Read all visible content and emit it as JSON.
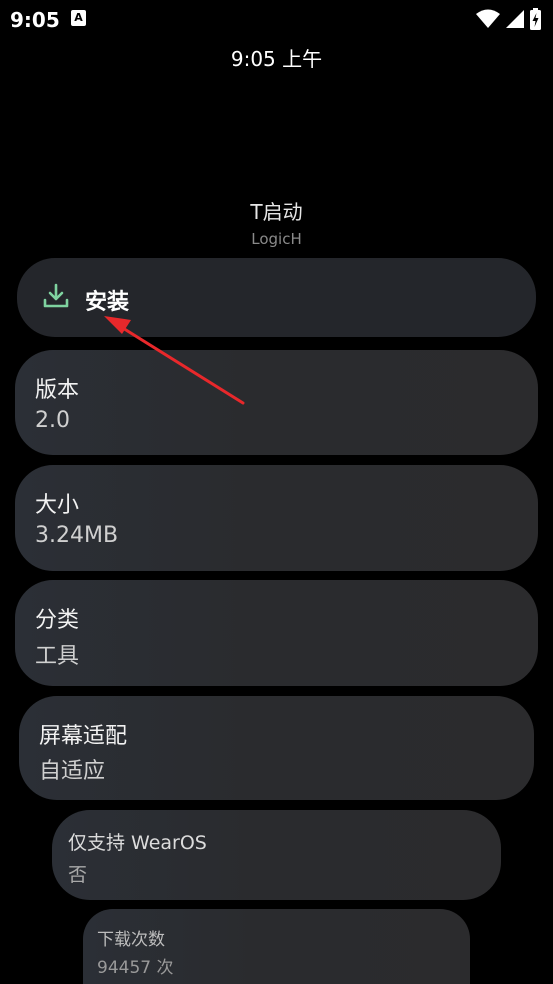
{
  "status_bar": {
    "time": "9:05",
    "notification_icon": "A",
    "icons": [
      "wifi-icon",
      "signal-icon",
      "battery-charging-icon"
    ]
  },
  "clock": "9:05 上午",
  "app": {
    "name": "T启动",
    "developer": "LogicH"
  },
  "install": {
    "label": "安装",
    "icon": "download-icon",
    "accent": "#7fd3a0"
  },
  "details": [
    {
      "label": "版本",
      "value": "2.0"
    },
    {
      "label": "大小",
      "value": "3.24MB"
    },
    {
      "label": "分类",
      "value": "工具"
    },
    {
      "label": "屏幕适配",
      "value": "自适应"
    },
    {
      "label": "仅支持 WearOS",
      "value": "否"
    },
    {
      "label": "下载次数",
      "value": "94457 次"
    }
  ],
  "annotation": {
    "color": "#e8282b"
  }
}
